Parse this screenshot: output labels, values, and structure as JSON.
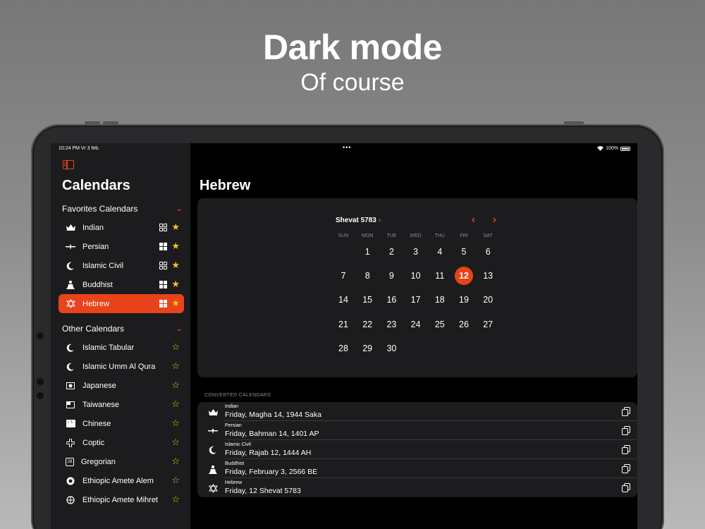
{
  "promo": {
    "headline": "Dark mode",
    "subline": "Of course"
  },
  "status_bar": {
    "time": "10:24 PM  Vr 3 feb.",
    "dots": "•••",
    "battery": "100%"
  },
  "sidebar": {
    "title": "Calendars",
    "favorites_header": "Favorites Calendars",
    "favorites": [
      {
        "label": "Indian",
        "icon": "crown-icon",
        "widget": "grid-outline",
        "selected": false
      },
      {
        "label": "Persian",
        "icon": "faravahar-icon",
        "widget": "grid-filled",
        "selected": false
      },
      {
        "label": "Islamic Civil",
        "icon": "crescent-icon",
        "widget": "grid-outline",
        "selected": false
      },
      {
        "label": "Buddhist",
        "icon": "buddha-icon",
        "widget": "grid-filled",
        "selected": false
      },
      {
        "label": "Hebrew",
        "icon": "star-of-david-icon",
        "widget": "grid-filled",
        "selected": true
      }
    ],
    "others_header": "Other Calendars",
    "others": [
      {
        "label": "Islamic Tabular",
        "icon": "crescent-icon"
      },
      {
        "label": "Islamic Umm Al Qura",
        "icon": "crescent-icon"
      },
      {
        "label": "Japanese",
        "icon": "japan-flag-icon"
      },
      {
        "label": "Taiwanese",
        "icon": "taiwan-flag-icon"
      },
      {
        "label": "Chinese",
        "icon": "china-flag-icon"
      },
      {
        "label": "Coptic",
        "icon": "coptic-cross-icon"
      },
      {
        "label": "Gregorian",
        "icon": "calendar-28-icon"
      },
      {
        "label": "Ethiopic Amete Alem",
        "icon": "ethiopic-icon"
      },
      {
        "label": "Ethiopic Amete Mihret",
        "icon": "ethiopic-mihret-icon"
      }
    ],
    "gregorian_icon_text": "28"
  },
  "main": {
    "title": "Hebrew",
    "month": "Shevat 5783",
    "weekdays": [
      "SUN",
      "MON",
      "TUE",
      "WED",
      "THU",
      "FRI",
      "SAT"
    ],
    "weeks": [
      [
        "",
        "1",
        "2",
        "3",
        "4",
        "5",
        "6"
      ],
      [
        "7",
        "8",
        "9",
        "10",
        "11",
        "12",
        "13"
      ],
      [
        "14",
        "15",
        "16",
        "17",
        "18",
        "19",
        "20"
      ],
      [
        "21",
        "22",
        "23",
        "24",
        "25",
        "26",
        "27"
      ],
      [
        "28",
        "29",
        "30",
        "",
        "",
        "",
        ""
      ]
    ],
    "today": "12",
    "converted_header": "CONVERTED CALENDARS",
    "converted": [
      {
        "name": "Indian",
        "date": "Friday, Magha 14, 1944 Saka",
        "icon": "crown-icon"
      },
      {
        "name": "Persian",
        "date": "Friday, Bahman 14, 1401 AP",
        "icon": "faravahar-icon"
      },
      {
        "name": "Islamic Civil",
        "date": "Friday, Rajab 12, 1444 AH",
        "icon": "crescent-icon"
      },
      {
        "name": "Buddhist",
        "date": "Friday, February 3, 2566 BE",
        "icon": "buddha-icon"
      },
      {
        "name": "Hebrew",
        "date": "Friday, 12 Shevat 5783",
        "icon": "star-of-david-icon"
      }
    ]
  },
  "colors": {
    "accent": "#e8431a",
    "star": "#f5c518",
    "card": "#1c1c1e",
    "sidebar": "#1c1c1e",
    "background": "#000000"
  }
}
